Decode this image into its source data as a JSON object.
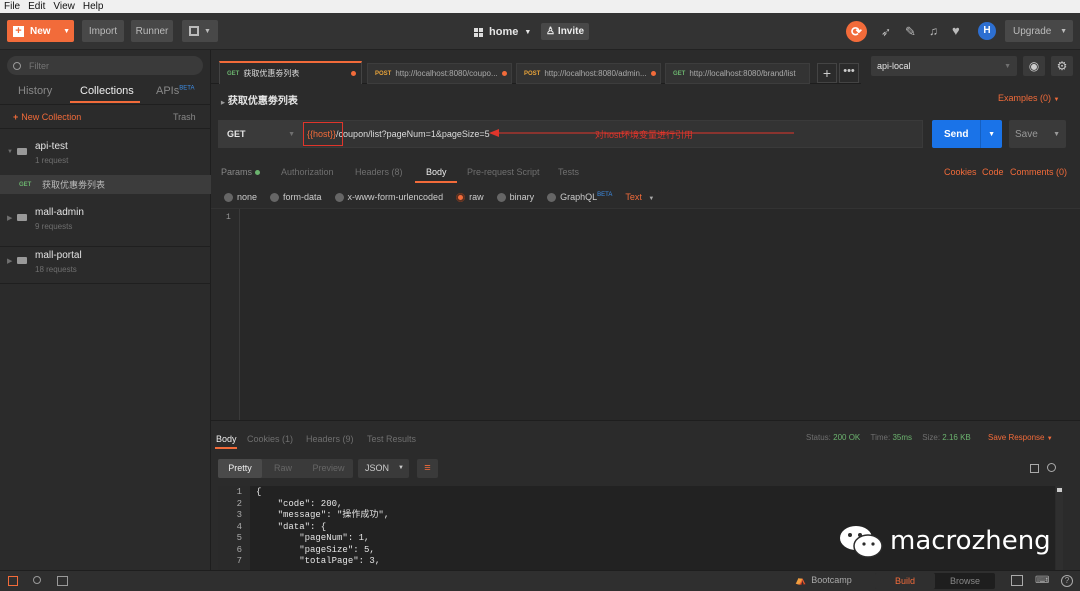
{
  "menu": [
    "File",
    "Edit",
    "View",
    "Help"
  ],
  "toolbar": {
    "new_label": "New",
    "import_label": "Import",
    "runner_label": "Runner",
    "workspace": "home",
    "invite_label": "Invite",
    "upgrade_label": "Upgrade"
  },
  "sidebar": {
    "filter_placeholder": "Filter",
    "tabs": [
      "History",
      "Collections",
      "APIs"
    ],
    "apis_badge": "BETA",
    "new_collection": "New Collection",
    "trash": "Trash",
    "collections": [
      {
        "name": "api-test",
        "count": "1 request",
        "items": [
          {
            "method": "GET",
            "name": "获取优惠劵列表"
          }
        ]
      },
      {
        "name": "mall-admin",
        "count": "9 requests"
      },
      {
        "name": "mall-portal",
        "count": "18 requests"
      }
    ]
  },
  "request_tabs": [
    {
      "method": "GET",
      "title": "获取优惠劵列表"
    },
    {
      "method": "POST",
      "title": "http://localhost:8080/coupo..."
    },
    {
      "method": "POST",
      "title": "http://localhost:8080/admin..."
    },
    {
      "method": "GET",
      "title": "http://localhost:8080/brand/list"
    }
  ],
  "environment": "api-local",
  "request": {
    "title": "获取优惠劵列表",
    "examples": "Examples (0)",
    "method": "GET",
    "url_var": "{{host}}",
    "url_rest": "/coupon/list?pageNum=1&pageSize=5",
    "annotation": "对host环境变量进行引用",
    "send": "Send",
    "save": "Save"
  },
  "req_tabs": {
    "params": "Params",
    "authorization": "Authorization",
    "headers": "Headers (8)",
    "body": "Body",
    "prerequest": "Pre-request Script",
    "tests": "Tests",
    "cookies": "Cookies",
    "code": "Code",
    "comments": "Comments (0)"
  },
  "body_types": {
    "none": "none",
    "form_data": "form-data",
    "urlencoded": "x-www-form-urlencoded",
    "raw": "raw",
    "binary": "binary",
    "graphql": "GraphQL",
    "beta": "BETA",
    "text": "Text"
  },
  "editor_line": "1",
  "response": {
    "tabs": {
      "body": "Body",
      "cookies": "Cookies (1)",
      "headers": "Headers (9)",
      "tests": "Test Results"
    },
    "status_label": "Status:",
    "status": "200 OK",
    "time_label": "Time:",
    "time": "35ms",
    "size_label": "Size:",
    "size": "2.16 KB",
    "save": "Save Response",
    "views": {
      "pretty": "Pretty",
      "raw": "Raw",
      "preview": "Preview",
      "format": "JSON"
    },
    "lines": [
      {
        "n": "1",
        "t": "{"
      },
      {
        "n": "2",
        "t": "    \"code\": 200,"
      },
      {
        "n": "3",
        "t": "    \"message\": \"操作成功\","
      },
      {
        "n": "4",
        "t": "    \"data\": {"
      },
      {
        "n": "5",
        "t": "        \"pageNum\": 1,"
      },
      {
        "n": "6",
        "t": "        \"pageSize\": 5,"
      },
      {
        "n": "7",
        "t": "        \"totalPage\": 3,"
      }
    ]
  },
  "watermark": "macrozheng",
  "statusbar": {
    "bootcamp": "Bootcamp",
    "build": "Build",
    "browse": "Browse"
  },
  "colors": {
    "accent": "#f26b3a",
    "send": "#1a73e8",
    "annotation": "#e0352b"
  }
}
